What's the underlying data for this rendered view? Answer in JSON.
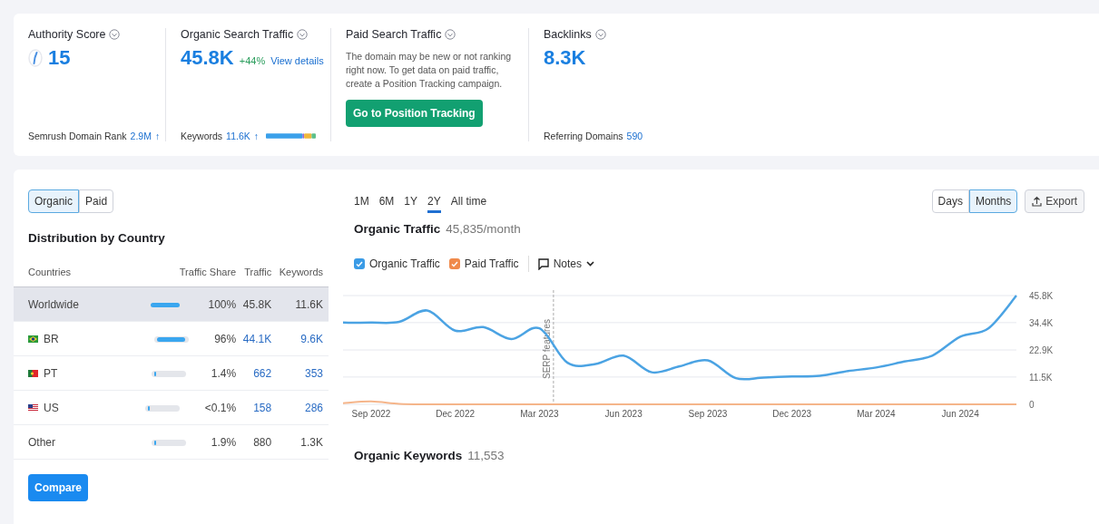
{
  "summary": [
    {
      "kind": "authority",
      "title": "Authority Score",
      "value": "15",
      "footer_label": "Semrush Domain Rank",
      "footer_value": "2.9M",
      "footer_trend": "↑"
    },
    {
      "kind": "traffic",
      "title": "Organic Search Traffic",
      "value": "45.8K",
      "change": "+44%",
      "link": "View details",
      "footer_label": "Keywords",
      "footer_value": "11.6K",
      "footer_trend": "↑"
    },
    {
      "kind": "paid",
      "title": "Paid Search Traffic",
      "message": "The domain may be new or not ranking right now. To get data on paid traffic, create a Position Tracking campaign.",
      "button": "Go to Position Tracking"
    },
    {
      "kind": "backlinks",
      "title": "Backlinks",
      "value": "8.3K",
      "footer_label": "Referring Domains",
      "footer_value": "590"
    }
  ],
  "source_toggle": [
    {
      "label": "Organic",
      "selected": true
    },
    {
      "label": "Paid",
      "selected": false
    }
  ],
  "distribution": {
    "title": "Distribution by Country",
    "columns": [
      "Countries",
      "Traffic Share",
      "Traffic",
      "Keywords"
    ],
    "rows": [
      {
        "kind": "plain",
        "country": "Worldwide",
        "level": 1,
        "share": "100%",
        "traffic": "45.8K",
        "keywords": "11.6K",
        "linked": false,
        "selected": true
      },
      {
        "kind": "brazil",
        "country": "BR",
        "level": 0.96,
        "share": "96%",
        "traffic": "44.1K",
        "keywords": "9.6K",
        "linked": true,
        "selected": false
      },
      {
        "kind": "portugal",
        "country": "PT",
        "level": 0.014,
        "share": "1.4%",
        "traffic": "662",
        "keywords": "353",
        "linked": true,
        "selected": false
      },
      {
        "kind": "usa",
        "country": "US",
        "level": 0.001,
        "share": "<0.1%",
        "traffic": "158",
        "keywords": "286",
        "linked": true,
        "selected": false
      },
      {
        "kind": "plain",
        "country": "Other",
        "level": 0.019,
        "share": "1.9%",
        "traffic": "880",
        "keywords": "1.3K",
        "linked": false,
        "selected": false
      }
    ]
  },
  "compare_button": "Compare",
  "periods": [
    {
      "label": "1M",
      "selected": false
    },
    {
      "label": "6M",
      "selected": false
    },
    {
      "label": "1Y",
      "selected": false
    },
    {
      "label": "2Y",
      "selected": true
    },
    {
      "label": "All time",
      "selected": false
    }
  ],
  "granularity": [
    {
      "label": "Days",
      "selected": false
    },
    {
      "label": "Months",
      "selected": true
    }
  ],
  "export_button": "Export",
  "organic_traffic": {
    "title": "Organic Traffic",
    "value": "45,835/month",
    "legend": [
      {
        "checked": true,
        "color": "#3a9be6"
      },
      {
        "checked": true,
        "color": "#f08a4b"
      }
    ],
    "notes": "Notes",
    "chart_data": {
      "type": "line",
      "categories": [
        null,
        "Sep 2022",
        null,
        null,
        "Dec 2022",
        null,
        null,
        "Mar 2023",
        null,
        null,
        "Jun 2023",
        null,
        null,
        "Sep 2023",
        null,
        null,
        "Dec 2023",
        null,
        null,
        "Mar 2024",
        null,
        null,
        "Jun 2024",
        null,
        null
      ],
      "series": [
        {
          "name": "Organic Traffic",
          "color": "#4ba3e3",
          "values": [
            34400,
            34400,
            34700,
            39500,
            31000,
            32500,
            27500,
            32000,
            17500,
            17000,
            20500,
            13500,
            16000,
            18500,
            11000,
            11300,
            11700,
            12000,
            14000,
            15500,
            18000,
            20500,
            28500,
            32000,
            45800
          ]
        },
        {
          "name": "Paid Traffic",
          "color": "#f5b58a",
          "values": [
            500,
            1200,
            200,
            0,
            0,
            0,
            0,
            0,
            0,
            0,
            0,
            0,
            0,
            0,
            0,
            0,
            0,
            0,
            0,
            0,
            0,
            0,
            0,
            0,
            0
          ]
        }
      ],
      "ylim": [
        0,
        45800
      ],
      "grid": true,
      "yticks": [
        0,
        {
          "value": 11500,
          "label": "11.5K"
        },
        {
          "value": 22900,
          "label": "22.9K"
        },
        {
          "value": 34400,
          "label": "34.4K"
        },
        {
          "value": 45800,
          "label": "45.8K"
        }
      ],
      "annotations": [
        "SERP features"
      ]
    }
  },
  "organic_keywords": {
    "title": "Organic Keywords",
    "value": "11,553"
  }
}
